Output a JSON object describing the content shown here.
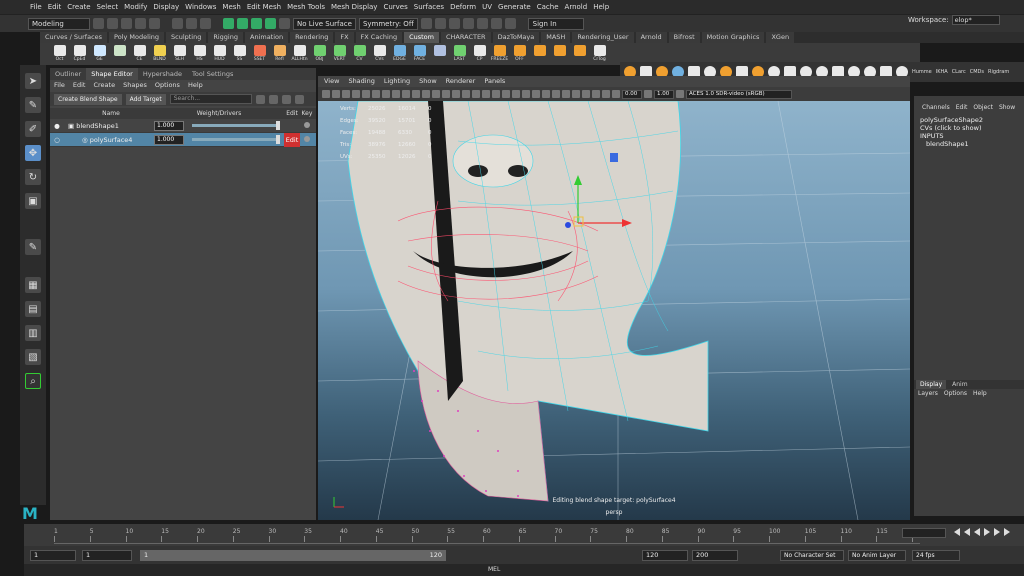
{
  "menubar": [
    "File",
    "Edit",
    "Create",
    "Select",
    "Modify",
    "Display",
    "Windows",
    "Mesh",
    "Edit Mesh",
    "Mesh Tools",
    "Mesh Display",
    "Curves",
    "Surfaces",
    "Deform",
    "UV",
    "Generate",
    "Cache",
    "Arnold",
    "Help"
  ],
  "status": {
    "mode": "Modeling",
    "live_surface": "No Live Surface",
    "symmetry": "Symmetry: Off",
    "sign_in": "Sign In",
    "workspace_label": "Workspace:",
    "workspace_value": "elop*"
  },
  "shelf_tabs": [
    "Curves / Surfaces",
    "Poly Modeling",
    "Sculpting",
    "Rigging",
    "Animation",
    "Rendering",
    "FX",
    "FX Caching",
    "Custom",
    "CHARACTER",
    "DazToMaya",
    "MASH",
    "Rendering_User",
    "Arnold",
    "Bifrost",
    "Motion Graphics",
    "XGen"
  ],
  "shelf_active": "Custom",
  "shelf_tools": [
    {
      "label": "Oct",
      "color": "#e9e9e9"
    },
    {
      "label": "CpEd",
      "color": "#e9e9e9"
    },
    {
      "label": "GE",
      "color": "#cfe8ff"
    },
    {
      "label": "",
      "color": "#cde4c8"
    },
    {
      "label": "CE",
      "color": "#e9e9e9"
    },
    {
      "label": "BLND",
      "color": "#f0d050"
    },
    {
      "label": "SLH",
      "color": "#e9e9e9"
    },
    {
      "label": "HS",
      "color": "#e9e9e9"
    },
    {
      "label": "HUD",
      "color": "#e9e9e9"
    },
    {
      "label": "SS",
      "color": "#e9e9e9"
    },
    {
      "label": "SSET",
      "color": "#f07050"
    },
    {
      "label": "Refl",
      "color": "#f0b060"
    },
    {
      "label": "ALLHtn",
      "color": "#e9e9e9"
    },
    {
      "label": "OBJ",
      "color": "#70d070"
    },
    {
      "label": "VERT",
      "color": "#70d070"
    },
    {
      "label": "CV",
      "color": "#70d070"
    },
    {
      "label": "CVs",
      "color": "#e9e9e9"
    },
    {
      "label": "EDGE",
      "color": "#70b0e0"
    },
    {
      "label": "FACE",
      "color": "#70b0e0"
    },
    {
      "label": "",
      "color": "#b0c0e0"
    },
    {
      "label": "LAST",
      "color": "#70d070"
    },
    {
      "label": "CP",
      "color": "#e9e9e9"
    },
    {
      "label": "FREEZE",
      "color": "#f0a030"
    },
    {
      "label": "OFF",
      "color": "#f0a030"
    },
    {
      "label": "",
      "color": "#f0a030"
    },
    {
      "label": "",
      "color": "#f0a030"
    },
    {
      "label": "",
      "color": "#f0a030"
    },
    {
      "label": "CrTog",
      "color": "#e9e9e9"
    }
  ],
  "right_icons": [
    "#f0a030",
    "#e9e9e9",
    "#f0a030",
    "#70b0e0",
    "#e9e9e9",
    "#e9e9e9",
    "#f0a030",
    "#e9e9e9",
    "#f0a030",
    "#e9e9e9",
    "#e9e9e9",
    "#e9e9e9",
    "#e9e9e9",
    "#e9e9e9",
    "#e9e9e9",
    "#e9e9e9",
    "#e9e9e9",
    "#e9e9e9"
  ],
  "right_icon_labels": [
    "Humme",
    "IKHA",
    "CLarc",
    "CMDs",
    "Rigdram"
  ],
  "left_panel": {
    "tabs": [
      "Outliner",
      "Shape Editor",
      "Hypershade",
      "Tool Settings"
    ],
    "active_tab": "Shape Editor",
    "menu": [
      "File",
      "Edit",
      "Create",
      "Shapes",
      "Options",
      "Help"
    ],
    "create_button": "Create Blend Shape",
    "add_target_button": "Add Target",
    "search_placeholder": "Search...",
    "columns": {
      "name": "Name",
      "weight": "Weight/Drivers",
      "edit": "Edit",
      "key": "Key"
    },
    "rows": [
      {
        "name": "blendShape1",
        "weight": "1.000",
        "level": 1.0,
        "selected": false
      },
      {
        "name": "polySurface4",
        "weight": "1.000",
        "level": 1.0,
        "selected": true
      }
    ]
  },
  "viewport": {
    "menu": [
      "View",
      "Shading",
      "Lighting",
      "Show",
      "Renderer",
      "Panels"
    ],
    "field_a": "0.00",
    "field_b": "1.00",
    "colorspace": "ACES 1.0 SDR-video (sRGB)",
    "hud": [
      {
        "k": "Verts:",
        "a": "25026",
        "b": "16014",
        "c": "0"
      },
      {
        "k": "Edges:",
        "a": "39520",
        "b": "15701",
        "c": "0"
      },
      {
        "k": "Faces:",
        "a": "19488",
        "b": "6330",
        "c": "0"
      },
      {
        "k": "Tris:",
        "a": "38976",
        "b": "12660",
        "c": "0"
      },
      {
        "k": "UVs:",
        "a": "25350",
        "b": "12026",
        "c": "0"
      }
    ],
    "caption": "Editing blend shape target: polySurface4",
    "camera": "persp"
  },
  "channel_box": {
    "menu": [
      "Channels",
      "Edit",
      "Object",
      "Show"
    ],
    "lines": [
      "polySurfaceShape2",
      "CVs (click to show)",
      "INPUTS",
      "  blendShape1"
    ],
    "layer_tabs": [
      "Display",
      "Anim"
    ],
    "layer_menu": [
      "Layers",
      "Options",
      "Help"
    ]
  },
  "timeline": {
    "ticks": [
      "1",
      "5",
      "10",
      "15",
      "20",
      "25",
      "30",
      "35",
      "40",
      "45",
      "50",
      "55",
      "60",
      "65",
      "70",
      "75",
      "80",
      "85",
      "90",
      "95",
      "100",
      "105",
      "110",
      "115",
      "120"
    ],
    "current": "1"
  },
  "range": {
    "start": "1",
    "start2": "1",
    "bar_start": "1",
    "bar_end": "120",
    "end": "120",
    "end2": "200",
    "character_set": "No Character Set",
    "anim_layer": "No Anim Layer",
    "fps": "24 fps"
  },
  "help": {
    "mel": "MEL"
  }
}
